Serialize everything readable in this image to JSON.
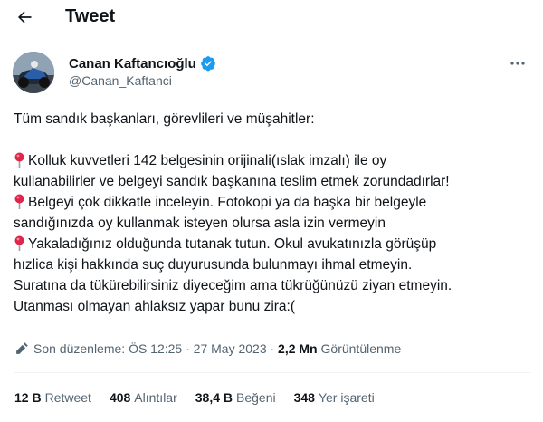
{
  "header": {
    "back_icon": "arrow-left-icon",
    "title": "Tweet"
  },
  "author": {
    "name": "Canan Kaftancıoğlu",
    "handle": "@Canan_Kaftanci",
    "verified_icon": "verified-badge-icon",
    "verified_color": "#1d9bf0"
  },
  "more_icon": "more-dots-icon",
  "tweet": {
    "greeting": "Tüm sandık başkanları, görevlileri ve müşahitler:",
    "lines": [
      "Kolluk kuvvetleri 142 belgesinin orijinali(ıslak imzalı) ile oy",
      "kullanabilirler ve belgeyi sandık başkanına teslim etmek zorundadırlar!",
      "Belgeyi çok dikkatle inceleyin. Fotokopi ya da başka bir belgeyle",
      "sandığınızda oy kullanmak isteyen olursa asla izin vermeyin",
      "Yakaladığınız olduğunda tutanak tutun. Okul avukatınızla görüşüp",
      "hızlica kişi hakkında suç duyurusunda bulunmayı ihmal etmeyin.",
      "Suratına da tükürebilirsiniz diyeceğim ama tükrüğünüzü ziyan etmeyin.",
      "Utanması olmayan ahlaksız yapar bunu zira:("
    ],
    "pin_icon": "round-pushpin-icon"
  },
  "meta": {
    "edit_icon": "pencil-icon",
    "edited_label": "Son düzenleme: ÖS 12:25 · 27 May 2023 · ",
    "views_count": "2,2 Mn",
    "views_label": " Görüntülenme"
  },
  "stats": [
    {
      "count": "12 B",
      "label": "Retweet"
    },
    {
      "count": "408",
      "label": "Alıntılar"
    },
    {
      "count": "38,4 B",
      "label": "Beğeni"
    },
    {
      "count": "348",
      "label": "Yer işareti"
    }
  ]
}
